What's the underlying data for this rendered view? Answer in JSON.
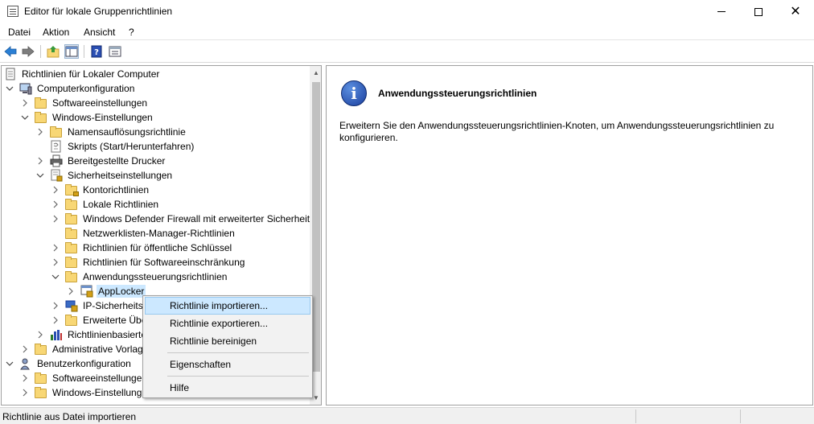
{
  "window": {
    "title": "Editor für lokale Gruppenrichtlinien",
    "minimize": "–",
    "maximize": "□",
    "close": "✕"
  },
  "menubar": [
    "Datei",
    "Aktion",
    "Ansicht",
    "?"
  ],
  "toolbar": [
    "back-icon",
    "forward-icon",
    "up-folder-icon",
    "show-hide-tree-icon",
    "help-icon",
    "properties-icon"
  ],
  "tree": {
    "root": "Richtlinien für Lokaler Computer",
    "computer": "Computerkonfiguration",
    "software": "Softwareeinstellungen",
    "windows": "Windows-Einstellungen",
    "names": "Namensauflösungsrichtlinie",
    "scripts": "Skripts (Start/Herunterfahren)",
    "printers": "Bereitgestellte Drucker",
    "security": "Sicherheitseinstellungen",
    "account": "Kontorichtlinien",
    "local": "Lokale Richtlinien",
    "firewall": "Windows Defender Firewall mit erweiterter Sicherheit",
    "netlist": "Netzwerklisten-Manager-Richtlinien",
    "pubkey": "Richtlinien für öffentliche Schlüssel",
    "softrestrict": "Richtlinien für Softwareeinschränkung",
    "appcontrol": "Anwendungssteuerungsrichtlinien",
    "applocker": "AppLocker",
    "ipsec": "IP-Sicherheitsr",
    "advanced": "Erweiterte Übe",
    "qos": "Richtlinienbasierte",
    "admin": "Administrative Vorlag",
    "user": "Benutzerkonfiguration",
    "user_software": "Softwareeinstellungen",
    "user_windows": "Windows-Einstellung"
  },
  "details": {
    "title": "Anwendungssteuerungsrichtlinien",
    "description": "Erweitern Sie den Anwendungssteuerungsrichtlinien-Knoten, um Anwendungssteuerungsrichtlinien zu konfigurieren."
  },
  "context_menu": {
    "import": "Richtlinie importieren...",
    "export": "Richtlinie exportieren...",
    "clear": "Richtlinie bereinigen",
    "properties": "Eigenschaften",
    "help": "Hilfe"
  },
  "status": {
    "text": "Richtlinie aus Datei importieren"
  },
  "colors": {
    "selection": "#cce8ff",
    "folder": "#f8d775",
    "info_icon": "#1a3f9e"
  }
}
